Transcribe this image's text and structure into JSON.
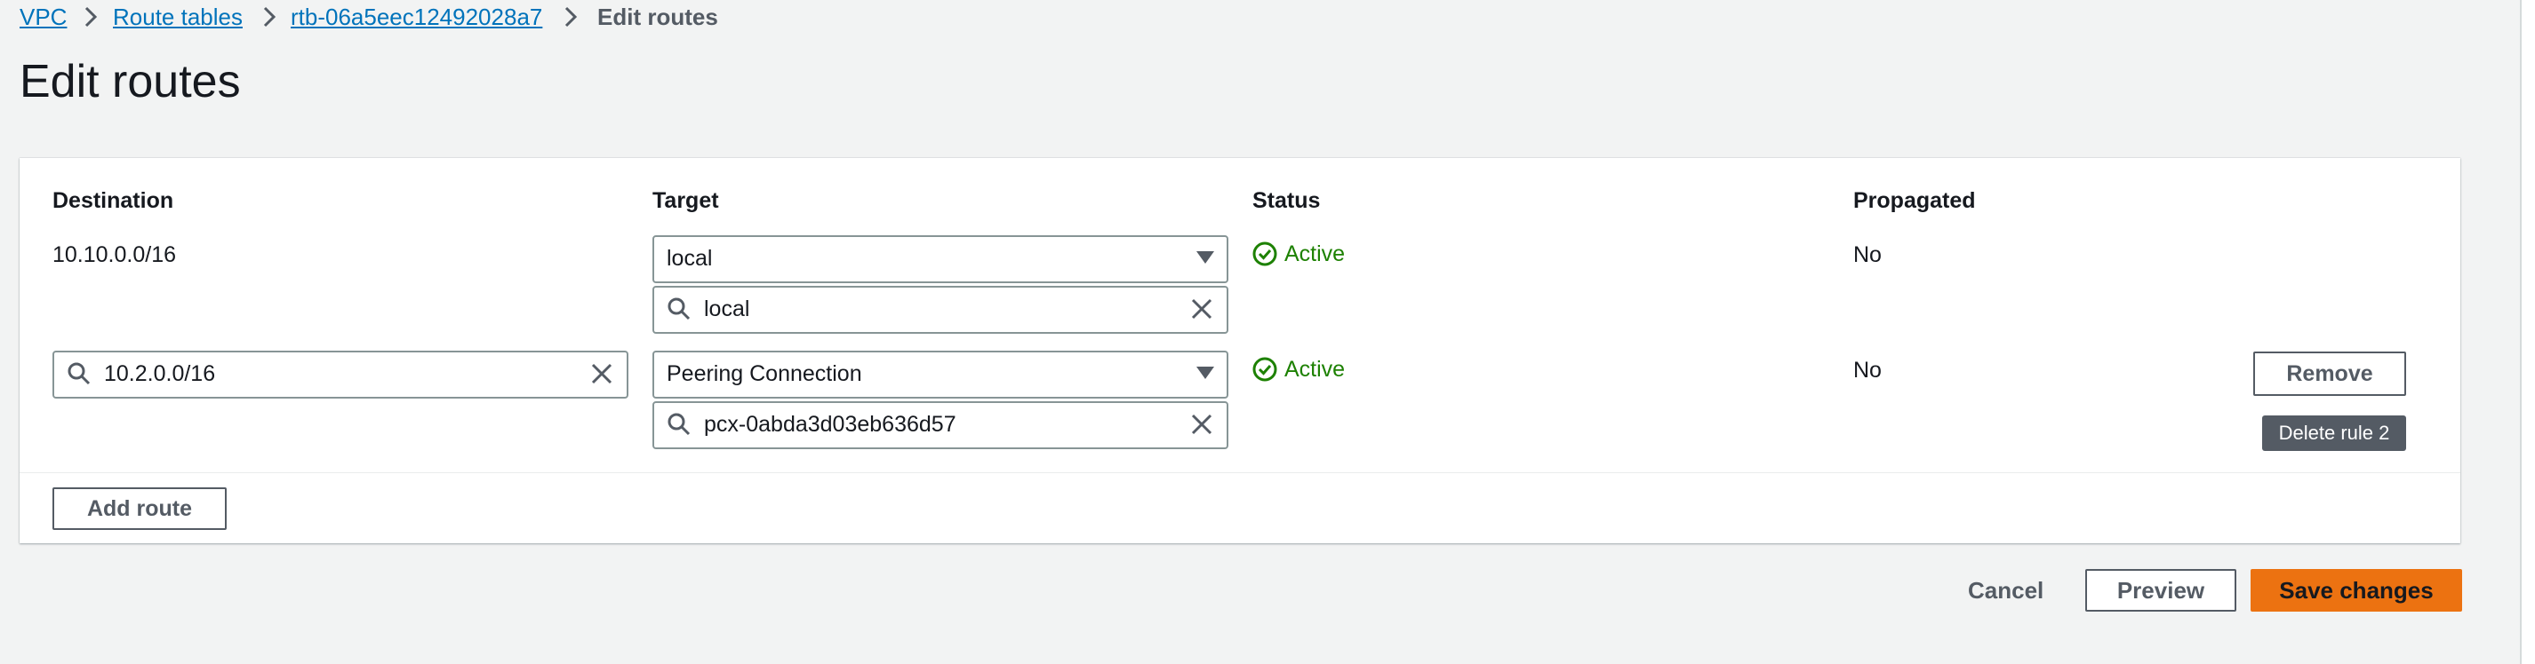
{
  "breadcrumb": {
    "items": [
      "VPC",
      "Route tables",
      "rtb-06a5eec12492028a7"
    ],
    "current": "Edit routes"
  },
  "page": {
    "title": "Edit routes"
  },
  "table": {
    "headers": {
      "destination": "Destination",
      "target": "Target",
      "status": "Status",
      "propagated": "Propagated"
    },
    "rows": [
      {
        "destination": "10.10.0.0/16",
        "target_type": "local",
        "target_value": "local",
        "status": "Active",
        "propagated": "No"
      },
      {
        "destination": "10.2.0.0/16",
        "target_type": "Peering Connection",
        "target_value": "pcx-0abda3d03eb636d57",
        "status": "Active",
        "propagated": "No",
        "remove_label": "Remove",
        "tooltip": "Delete rule 2"
      }
    ]
  },
  "actions": {
    "add_route": "Add route",
    "cancel": "Cancel",
    "preview": "Preview",
    "save": "Save changes"
  },
  "colors": {
    "link": "#0073bb",
    "status_active": "#1d8102",
    "primary_button": "#ec7211",
    "background": "#f2f3f3"
  }
}
